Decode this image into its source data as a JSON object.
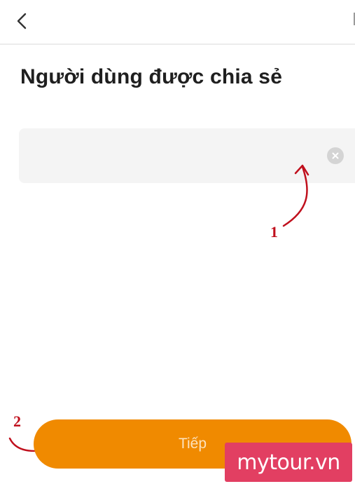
{
  "header": {
    "back_icon": "chevron-left-icon"
  },
  "page": {
    "title": "Người dùng được chia sẻ"
  },
  "search": {
    "value": "",
    "placeholder": "",
    "clear_icon": "clear-circle-icon"
  },
  "annotations": {
    "step_1": "1",
    "step_2": "2",
    "color": "#c0101d"
  },
  "footer": {
    "next_label": "Tiếp",
    "button_color": "#f08a00"
  },
  "watermark": {
    "text": "mytour.vn",
    "color": "#e23f62"
  }
}
